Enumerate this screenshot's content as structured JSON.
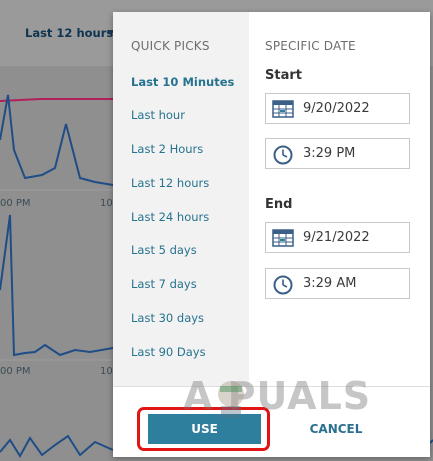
{
  "background": {
    "range_selector": "Last 12 hours",
    "axis_labels": [
      "00 PM",
      "10",
      "00 PM",
      "10"
    ]
  },
  "popup": {
    "quick_picks": {
      "title": "QUICK PICKS",
      "items": [
        {
          "label": "Last 10 Minutes",
          "active": true
        },
        {
          "label": "Last hour"
        },
        {
          "label": "Last 2 Hours"
        },
        {
          "label": "Last 12 hours"
        },
        {
          "label": "Last 24 hours"
        },
        {
          "label": "Last 5 days"
        },
        {
          "label": "Last 7 days"
        },
        {
          "label": "Last 30 days"
        },
        {
          "label": "Last 90 Days"
        }
      ]
    },
    "specific_date": {
      "title": "SPECIFIC DATE",
      "start_label": "Start",
      "start_date": "9/20/2022",
      "start_time": "3:29 PM",
      "end_label": "End",
      "end_date": "9/21/2022",
      "end_time": "3:29 AM"
    },
    "footer": {
      "use_label": "USE",
      "cancel_label": "CANCEL"
    }
  },
  "watermark": "A  PUALS",
  "colors": {
    "accent": "#2e7f9e",
    "link": "#26738f",
    "highlight": "#e01616",
    "chart_line": "#1f4d86",
    "chart_threshold": "#b0205a"
  }
}
